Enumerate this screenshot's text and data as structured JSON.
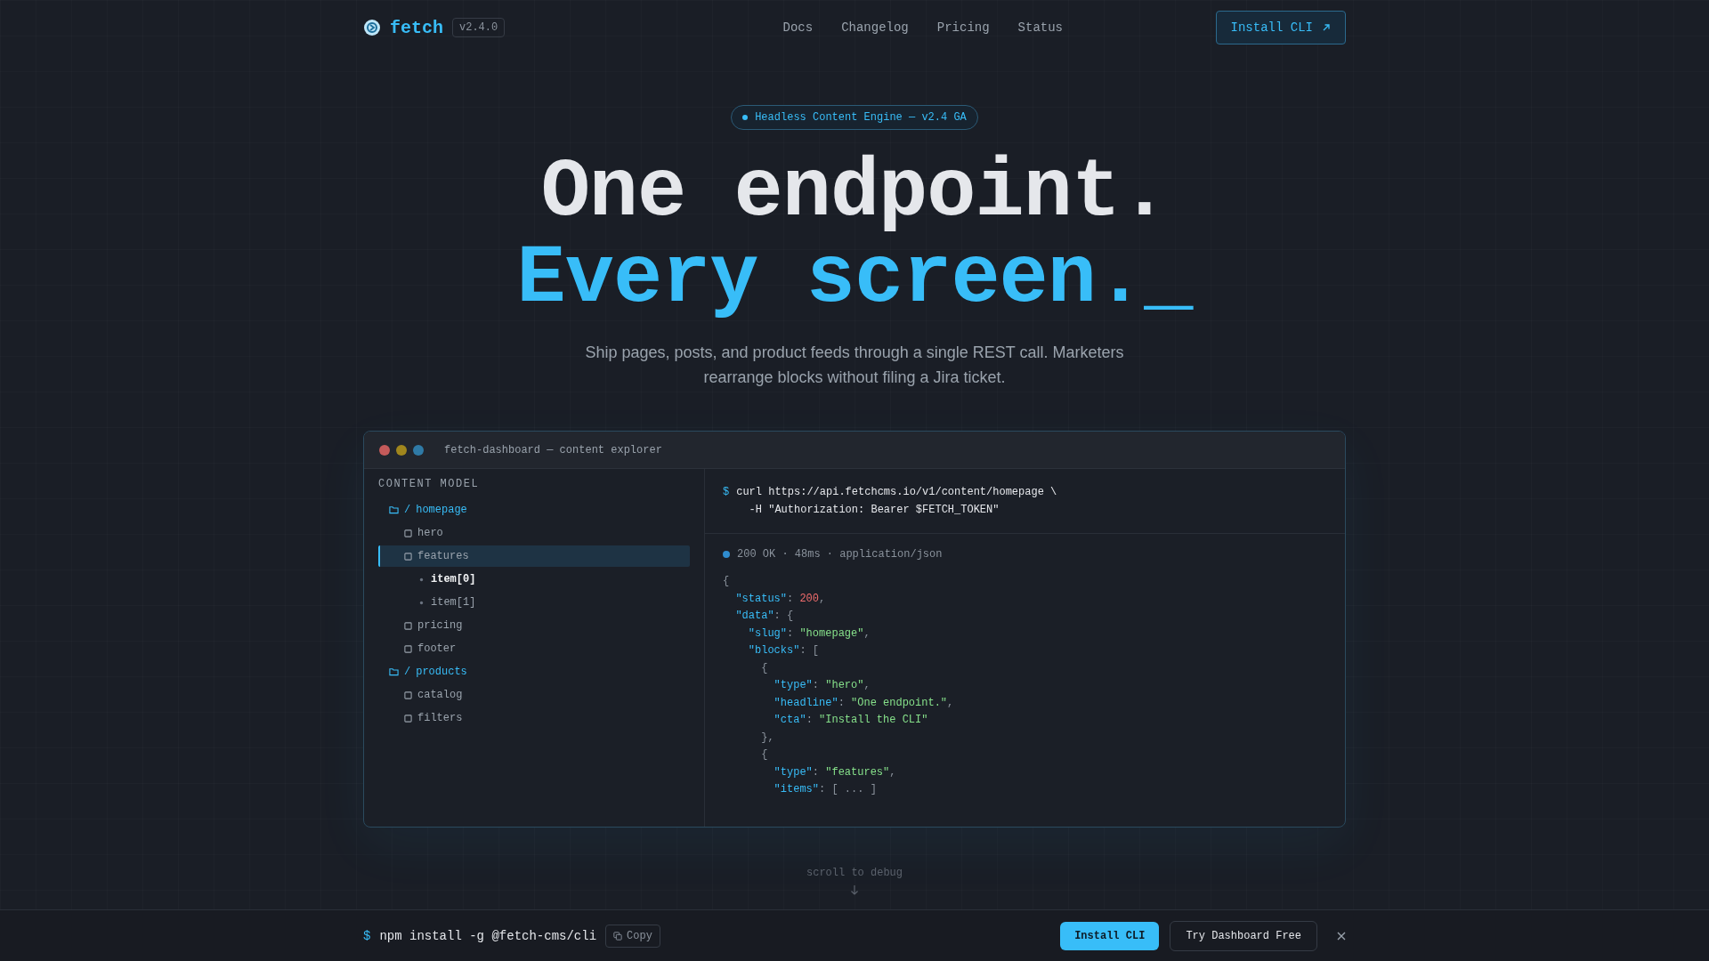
{
  "header": {
    "brand": "fetch",
    "version": "v2.4.0",
    "nav": [
      "Docs",
      "Changelog",
      "Pricing",
      "Status"
    ],
    "cta": "Install CLI"
  },
  "hero": {
    "badge": "Headless Content Engine — v2.4 GA",
    "headline_1": "One endpoint.",
    "headline_2": "Every screen._",
    "subtitle": "Ship pages, posts, and product feeds through a single REST call. Marketers rearrange blocks without filing a Jira ticket."
  },
  "dashboard": {
    "title": "fetch-dashboard — content explorer",
    "sidebar_heading": "CONTENT MODEL",
    "tree": [
      {
        "kind": "folder",
        "slash": "/",
        "label": "homepage",
        "selected": false,
        "children": [
          {
            "kind": "block",
            "label": "hero",
            "selected": false
          },
          {
            "kind": "block",
            "label": "features",
            "selected": true,
            "children": [
              {
                "kind": "item",
                "label": "item[0]",
                "selected": false,
                "current": true
              },
              {
                "kind": "item",
                "label": "item[1]",
                "selected": false,
                "current": false
              }
            ]
          },
          {
            "kind": "block",
            "label": "pricing",
            "selected": false
          },
          {
            "kind": "block",
            "label": "footer",
            "selected": false
          }
        ]
      },
      {
        "kind": "folder",
        "slash": "/",
        "label": "products",
        "selected": false,
        "children": [
          {
            "kind": "block",
            "label": "catalog",
            "selected": false
          },
          {
            "kind": "block",
            "label": "filters",
            "selected": false
          }
        ]
      }
    ],
    "request": {
      "prompt": "$",
      "lines": [
        "curl https://api.fetchcms.io/v1/content/homepage \\",
        "  -H \"Authorization: Bearer $FETCH_TOKEN\""
      ]
    },
    "response_status": "200 OK · 48ms · application/json",
    "code": [
      [
        {
          "kind": "punct",
          "text": "{"
        }
      ],
      [
        {
          "kind": "key",
          "text": "  \"status\""
        },
        {
          "kind": "punct",
          "text": ": "
        },
        {
          "kind": "num",
          "text": "200"
        },
        {
          "kind": "punct",
          "text": ","
        }
      ],
      [
        {
          "kind": "key",
          "text": "  \"data\""
        },
        {
          "kind": "punct",
          "text": ": {"
        }
      ],
      [
        {
          "kind": "key",
          "text": "    \"slug\""
        },
        {
          "kind": "punct",
          "text": ": "
        },
        {
          "kind": "str",
          "text": "\"homepage\""
        },
        {
          "kind": "punct",
          "text": ","
        }
      ],
      [
        {
          "kind": "key",
          "text": "    \"blocks\""
        },
        {
          "kind": "punct",
          "text": ": ["
        }
      ],
      [
        {
          "kind": "punct",
          "text": "      {"
        }
      ],
      [
        {
          "kind": "key",
          "text": "        \"type\""
        },
        {
          "kind": "punct",
          "text": ": "
        },
        {
          "kind": "str",
          "text": "\"hero\""
        },
        {
          "kind": "punct",
          "text": ","
        }
      ],
      [
        {
          "kind": "key",
          "text": "        \"headline\""
        },
        {
          "kind": "punct",
          "text": ": "
        },
        {
          "kind": "str",
          "text": "\"One endpoint.\""
        },
        {
          "kind": "punct",
          "text": ","
        }
      ],
      [
        {
          "kind": "key",
          "text": "        \"cta\""
        },
        {
          "kind": "punct",
          "text": ": "
        },
        {
          "kind": "str",
          "text": "\"Install the CLI\""
        }
      ],
      [
        {
          "kind": "punct",
          "text": "      },"
        }
      ],
      [
        {
          "kind": "punct",
          "text": "      {"
        }
      ],
      [
        {
          "kind": "key",
          "text": "        \"type\""
        },
        {
          "kind": "punct",
          "text": ": "
        },
        {
          "kind": "str",
          "text": "\"features\""
        },
        {
          "kind": "punct",
          "text": ","
        }
      ],
      [
        {
          "kind": "key",
          "text": "        \"items\""
        },
        {
          "kind": "punct",
          "text": ": [ ... ]"
        }
      ]
    ]
  },
  "scroll_hint": "scroll to debug",
  "install_bar": {
    "prompt": "$",
    "command": "npm install -g @fetch-cms/cli",
    "copy": "Copy",
    "primary": "Install CLI",
    "secondary": "Try Dashboard Free"
  }
}
